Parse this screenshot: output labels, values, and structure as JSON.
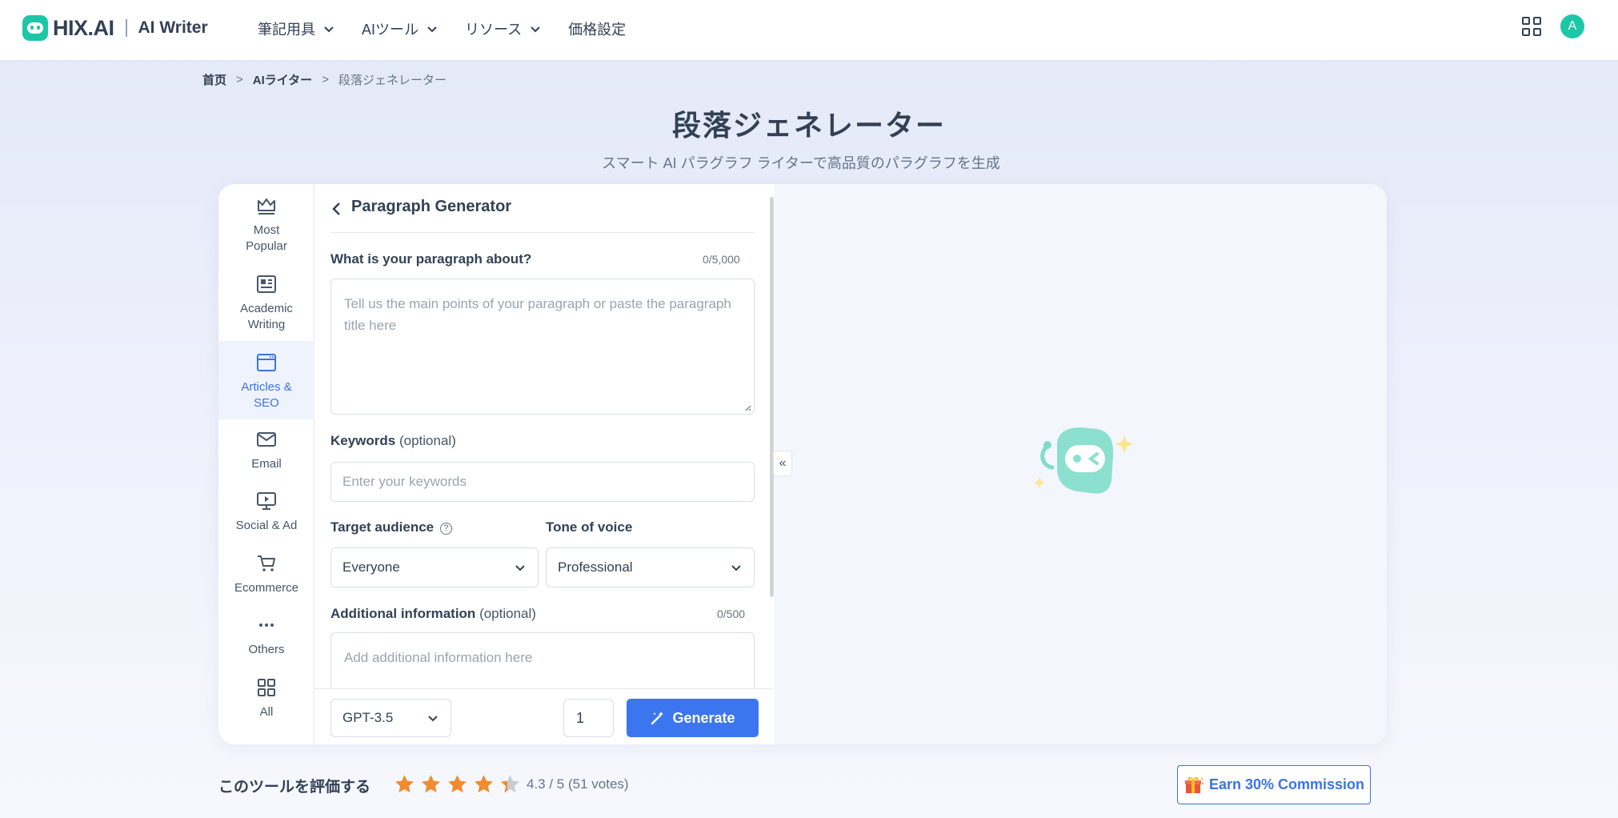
{
  "header": {
    "logo_text": "HIX.AI",
    "product": "AI Writer",
    "nav": [
      "筆記用具",
      "AIツール",
      "リソース",
      "価格設定"
    ],
    "avatar_letter": "A"
  },
  "breadcrumb": {
    "items": [
      "首页",
      "AIライター"
    ],
    "current": "段落ジェネレーター",
    "separator": ">"
  },
  "page": {
    "title": "段落ジェネレーター",
    "subtitle": "スマート AI パラグラフ ライターで高品質のパラグラフを生成"
  },
  "sidebar": {
    "items": [
      {
        "label": "Most Popular",
        "icon": "crown-icon"
      },
      {
        "label": "Academic Writing",
        "icon": "newspaper-icon"
      },
      {
        "label": "Articles & SEO",
        "icon": "browser-window-icon",
        "active": true
      },
      {
        "label": "Email",
        "icon": "envelope-icon"
      },
      {
        "label": "Social & Ad",
        "icon": "presentation-icon"
      },
      {
        "label": "Ecommerce",
        "icon": "cart-icon"
      },
      {
        "label": "Others",
        "icon": "ellipsis-icon"
      },
      {
        "label": "All",
        "icon": "grid-icon"
      }
    ]
  },
  "form": {
    "title": "Paragraph Generator",
    "topic": {
      "label": "What is your paragraph about?",
      "counter": "0/5,000",
      "placeholder": "Tell us the main points of your paragraph or paste the paragraph title here"
    },
    "keywords": {
      "label": "Keywords",
      "optional": "(optional)",
      "placeholder": "Enter your keywords"
    },
    "audience": {
      "label": "Target audience",
      "value": "Everyone"
    },
    "tone": {
      "label": "Tone of voice",
      "value": "Professional"
    },
    "additional": {
      "label": "Additional information",
      "optional": "(optional)",
      "counter": "0/500",
      "placeholder": "Add additional information here"
    },
    "model": "GPT-3.5",
    "count": "1",
    "generate_label": "Generate"
  },
  "output": {
    "collapse_glyph": "«"
  },
  "rating": {
    "label": "このツールを評価する",
    "text": "4.3 / 5 (51 votes)",
    "value": 4.3,
    "max": 5
  },
  "commission_label": "Earn 30% Commission",
  "colors": {
    "accent": "#3b76ef",
    "brand": "#1cc7a6",
    "star": "#f28a2e"
  }
}
